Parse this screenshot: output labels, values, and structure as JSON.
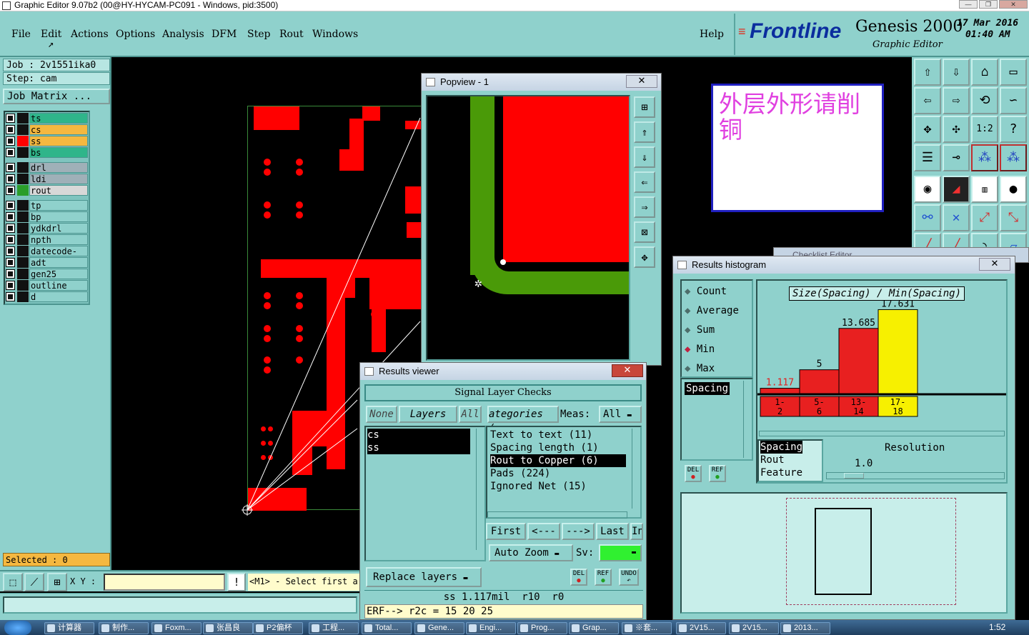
{
  "window": {
    "title": "Graphic Editor 9.07b2 (00@HY-HYCAM-PC091 - Windows, pid:3500)"
  },
  "menu": {
    "items": [
      "File",
      "Edit",
      "Actions",
      "Options",
      "Analysis",
      "DFM",
      "Step",
      "Rout",
      "Windows"
    ],
    "help": "Help"
  },
  "brand": {
    "logo": "Frontline",
    "product": "Genesis 2000",
    "subtitle": "Graphic Editor",
    "date": "17 Mar 2016",
    "time": "01:40 AM"
  },
  "job": {
    "job_label": "Job : 2v1551ika0",
    "step_label": "Step: cam",
    "matrix_button": "Job Matrix ..."
  },
  "layers": [
    {
      "name": "ts",
      "swatch": "#111",
      "bg": "#2fb58a"
    },
    {
      "name": "cs",
      "swatch": "#111",
      "bg": "#f5b840"
    },
    {
      "name": "ss",
      "swatch": "#f00",
      "bg": "#f5b840"
    },
    {
      "name": "bs",
      "swatch": "#111",
      "bg": "#2fb58a"
    },
    {
      "name": "drl",
      "swatch": "#111",
      "bg": "#9fb0b8"
    },
    {
      "name": "ldi",
      "swatch": "#111",
      "bg": "#9fb0b8"
    },
    {
      "name": "rout",
      "swatch": "#2a9d2a",
      "bg": "#d8d8d8"
    },
    {
      "name": "tp",
      "swatch": "#111",
      "bg": "#8fd1cc"
    },
    {
      "name": "bp",
      "swatch": "#111",
      "bg": "#8fd1cc"
    },
    {
      "name": "ydkdrl",
      "swatch": "#111",
      "bg": "#8fd1cc"
    },
    {
      "name": "npth",
      "swatch": "#111",
      "bg": "#8fd1cc"
    },
    {
      "name": "datecode-bs",
      "swatch": "#111",
      "bg": "#8fd1cc"
    },
    {
      "name": "adt",
      "swatch": "#111",
      "bg": "#8fd1cc"
    },
    {
      "name": "gen25",
      "swatch": "#111",
      "bg": "#8fd1cc"
    },
    {
      "name": "outline",
      "swatch": "#111",
      "bg": "#8fd1cc"
    },
    {
      "name": "d",
      "swatch": "#111",
      "bg": "#8fd1cc"
    }
  ],
  "status": {
    "selected": "Selected : 0",
    "xy_label": "X Y :",
    "prompt": "<M1> - Select first a"
  },
  "note": {
    "text": "外层外形请削铜"
  },
  "popview": {
    "title": "Popview - 1"
  },
  "results_viewer": {
    "title": "Results viewer",
    "header": "Signal Layer Checks",
    "none_btn": "None",
    "layers_btn": "Layers",
    "all_btn": "All",
    "categories_btn": "ategories (:",
    "meas_label": "Meas:",
    "meas_value": "All",
    "layer_list": [
      "cs",
      "ss"
    ],
    "results": [
      "Text to text (11)",
      "Spacing length (1)",
      "Rout to Copper (6)",
      "Pads (224)",
      "Ignored Net (15)"
    ],
    "selected_result": "Rout to Copper (6)",
    "nav": {
      "first": "First",
      "prev": "<---",
      "next": "--->",
      "last": "Last",
      "in": "In"
    },
    "auto_zoom": "Auto Zoom",
    "sv_label": "Sv:",
    "replace_layers": "Replace layers",
    "del": "DEL",
    "ref": "REF",
    "undo": "UNDO",
    "measure_line": "ss 1.117mil  r10  r0",
    "erf_line": "ERF--> r2c = 15 20 25"
  },
  "histogram": {
    "title": "Results histogram",
    "modes": [
      "Count",
      "Average",
      "Sum",
      "Min",
      "Max"
    ],
    "selected_mode": "Min",
    "list": [
      "Spacing"
    ],
    "header": "Size(Spacing) / Min(Spacing)",
    "resolution_label": "Resolution",
    "resolution_value": "1.0",
    "filter_list": [
      "Spacing",
      "Rout",
      "Feature"
    ],
    "del": "DEL",
    "ref": "REF"
  },
  "chart_data": {
    "type": "bar",
    "categories": [
      "1-\n2",
      "5-\n6",
      "13-\n14",
      "17-\n18"
    ],
    "values": [
      1.117,
      5,
      13.685,
      17.631
    ],
    "labels": [
      "1.117",
      "5",
      "13.685",
      "17.631"
    ],
    "colors": [
      "#e82020",
      "#e82020",
      "#e82020",
      "#f7f000"
    ],
    "ylim": [
      0,
      18
    ]
  },
  "taskbar": {
    "items": [
      "计算器",
      "制作...",
      "Foxm...",
      "张昌良",
      "P2偏杯",
      "工程...",
      "Total...",
      "Gene...",
      "Engi...",
      "Prog...",
      "Grap...",
      "※套...",
      "2V15...",
      "2V15...",
      "2013..."
    ],
    "clock": "1:52"
  }
}
